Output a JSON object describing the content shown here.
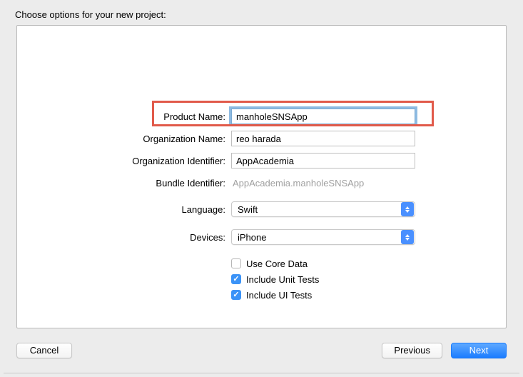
{
  "title": "Choose options for your new project:",
  "labels": {
    "product_name": "Product Name:",
    "org_name": "Organization Name:",
    "org_id": "Organization Identifier:",
    "bundle_id": "Bundle Identifier:",
    "language": "Language:",
    "devices": "Devices:"
  },
  "values": {
    "product_name": "manholeSNSApp",
    "org_name": "reo harada",
    "org_id": "AppAcademia",
    "bundle_id": "AppAcademia.manholeSNSApp",
    "language": "Swift",
    "devices": "iPhone"
  },
  "checkboxes": {
    "core_data": {
      "label": "Use Core Data",
      "checked": false
    },
    "unit_tests": {
      "label": "Include Unit Tests",
      "checked": true
    },
    "ui_tests": {
      "label": "Include UI Tests",
      "checked": true
    }
  },
  "buttons": {
    "cancel": "Cancel",
    "previous": "Previous",
    "next": "Next"
  }
}
